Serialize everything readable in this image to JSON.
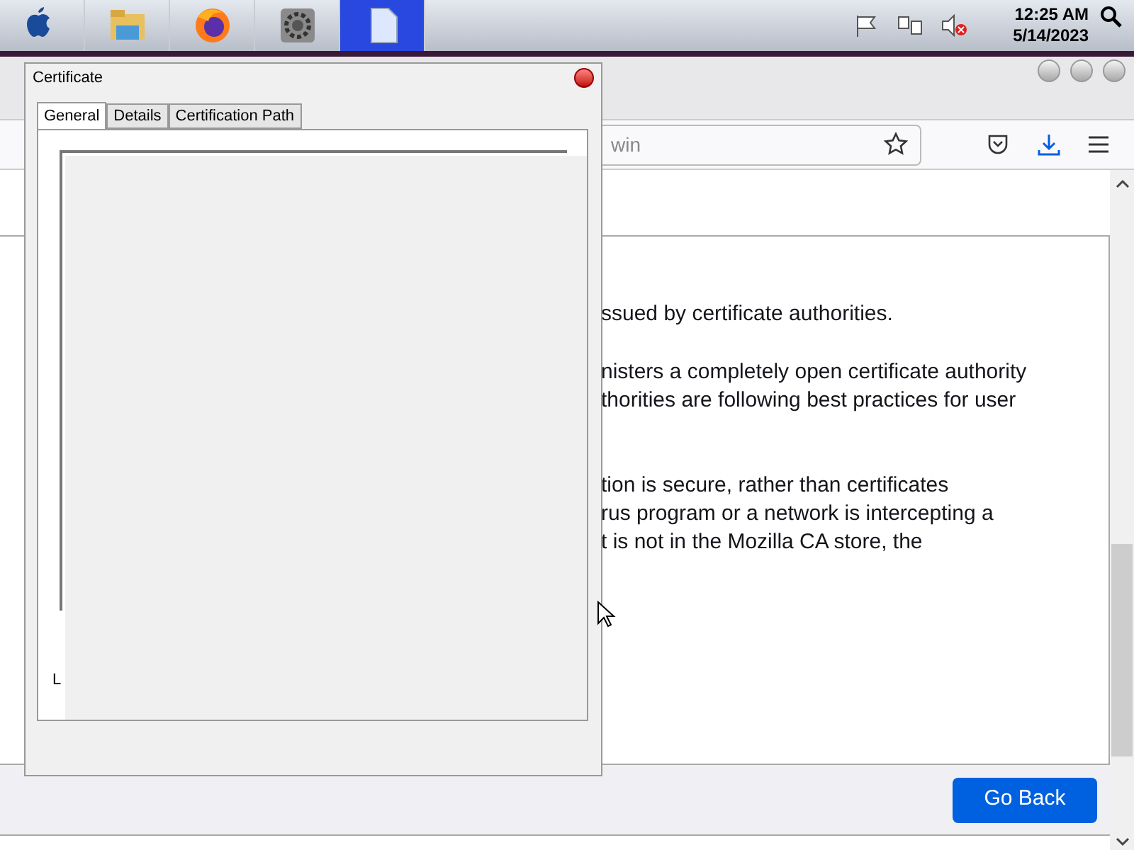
{
  "taskbar": {
    "apps": [
      {
        "kind": "apple",
        "selected": false
      },
      {
        "kind": "folder",
        "selected": false
      },
      {
        "kind": "firefox",
        "selected": false
      },
      {
        "kind": "settings",
        "selected": false
      },
      {
        "kind": "document",
        "selected": true
      }
    ],
    "tray": {
      "volume_muted": true
    },
    "clock": {
      "time": "12:25 AM",
      "date": "5/14/2023"
    }
  },
  "browser": {
    "url_fragment": "win",
    "paragraphs": [
      [
        "ssued by certificate authorities."
      ],
      [
        "nisters a completely open certificate authority",
        "thorities are following best practices for user"
      ],
      [
        "tion is secure, rather than certificates",
        "rus program or a network is intercepting a",
        "t is not in the Mozilla CA store, the"
      ]
    ],
    "go_back": "Go Back"
  },
  "dialog": {
    "title": "Certificate",
    "tabs": [
      {
        "label": "General",
        "selected": true
      },
      {
        "label": "Details",
        "selected": false
      },
      {
        "label": "Certification Path",
        "selected": false
      }
    ],
    "partial_label": "L"
  }
}
